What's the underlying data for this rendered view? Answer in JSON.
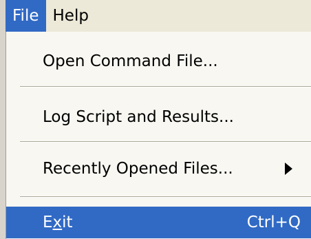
{
  "menubar": {
    "file_label": "File",
    "help_label": "Help"
  },
  "file_menu": {
    "open_label": "Open Command File...",
    "log_label": "Log Script and Results...",
    "recent_label": "Recently Opened Files...",
    "exit_label_pre": "E",
    "exit_label_mnemonic": "x",
    "exit_label_post": "it",
    "exit_shortcut": "Ctrl+Q"
  }
}
